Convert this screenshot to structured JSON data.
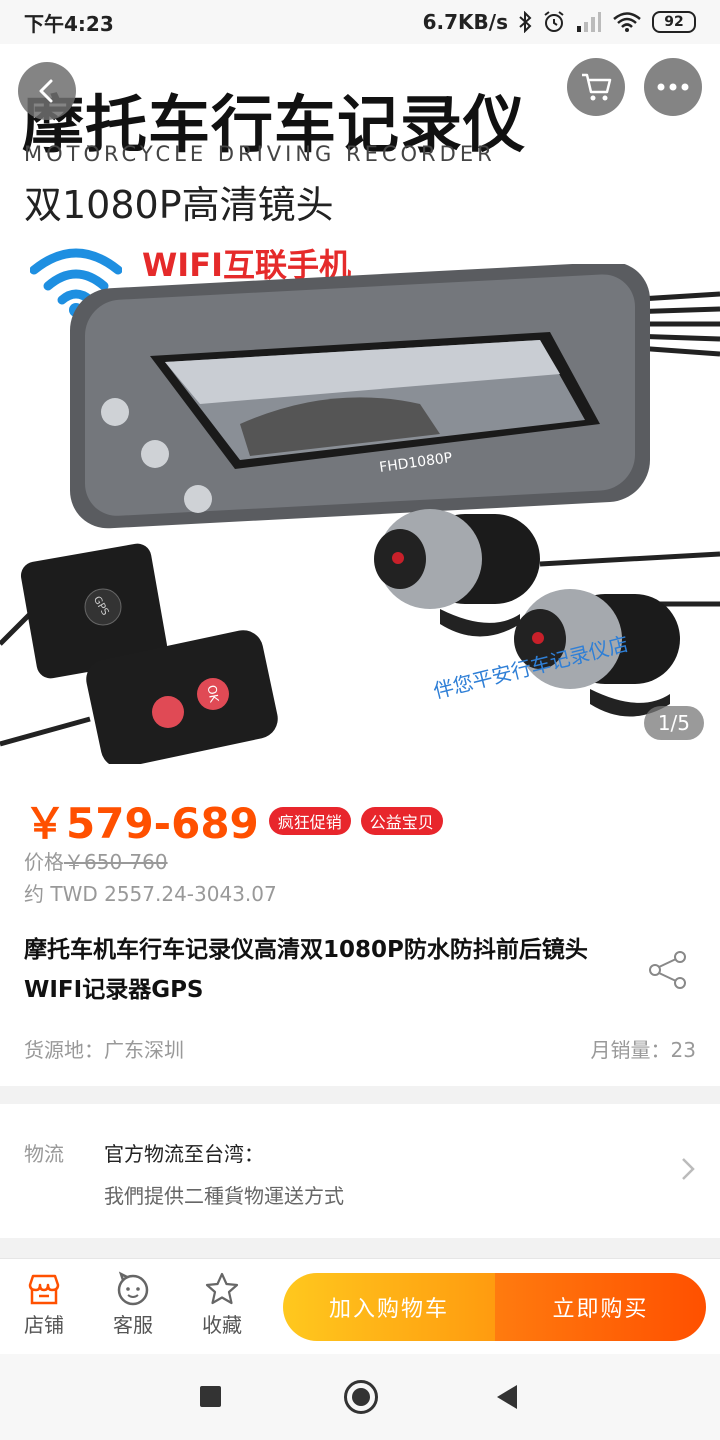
{
  "status_bar": {
    "time": "下午4:23",
    "network_speed": "6.7KB/s",
    "battery": "92",
    "icons": [
      "bluetooth-icon",
      "alarm-icon",
      "signal-icon",
      "wifi-icon",
      "battery-icon"
    ]
  },
  "hero": {
    "title": "摩托车行车记录仪",
    "subtitle_en": "MOTORCYCLE DRIVING RECORDER",
    "subtitle_cn": "双1080P高清镜头",
    "wifi_text": "WIFI互联手机",
    "screen_label": "FHD1080P",
    "gps_label": "GPS",
    "remote_label": "OK",
    "watermark": "伴您平安行车记录仪店",
    "counter": "1/5",
    "icons": [
      "back-icon",
      "cart-icon",
      "more-icon"
    ]
  },
  "price": {
    "current": "￥579-689",
    "tags": [
      "疯狂促销",
      "公益宝贝"
    ],
    "original_label": "价格",
    "original_value": "￥650-760",
    "converted": "约 TWD 2557.24-3043.07"
  },
  "product": {
    "title": "摩托车机车行车记录仪高清双1080P防水防抖前后镜头WIFI记录器GPS",
    "origin": "货源地：广东深圳",
    "sales": "月销量：23"
  },
  "logistics": {
    "label": "物流",
    "line1": "官方物流至台湾：",
    "line2": "我們提供二種貨物運送方式"
  },
  "actions": {
    "shop": "店铺",
    "service": "客服",
    "favorite": "收藏",
    "add_to_cart": "加入购物车",
    "buy_now": "立即购买"
  },
  "colors": {
    "price": "#ff5000",
    "tag": "#e8262c",
    "cart_button": "#ffb01a",
    "buy_button": "#ff5f08"
  }
}
